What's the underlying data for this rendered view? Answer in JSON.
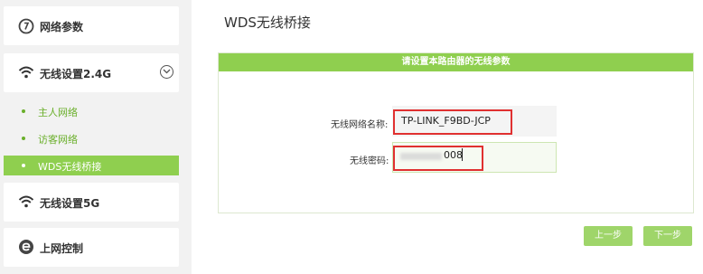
{
  "sidebar": {
    "network_params": "网络参数",
    "wireless_24": "无线设置2.4G",
    "sub_items": [
      "主人网络",
      "访客网络",
      "WDS无线桥接"
    ],
    "wireless_5": "无线设置5G",
    "access_control": "上网控制"
  },
  "main": {
    "title": "WDS无线桥接",
    "panel_header": "请设置本路由器的无线参数",
    "ssid_label": "无线网络名称:",
    "ssid_value": "TP-LINK_F9BD-JCP",
    "password_label": "无线密码:",
    "password_visible_tail": "008",
    "prev_button": "上一步",
    "next_button": "下一步"
  },
  "colors": {
    "accent": "#8fcf4f",
    "highlight": "#e03030"
  }
}
